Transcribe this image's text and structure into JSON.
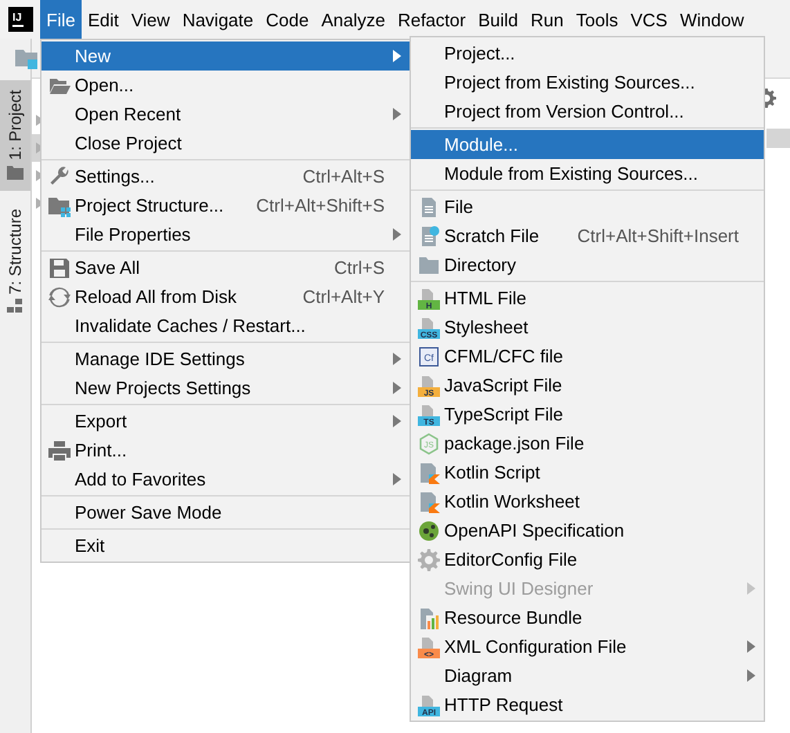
{
  "logo": {
    "text": "IJ"
  },
  "menubar": {
    "items": [
      {
        "label": "File",
        "selected": true
      },
      {
        "label": "Edit",
        "selected": false
      },
      {
        "label": "View",
        "selected": false
      },
      {
        "label": "Navigate",
        "selected": false
      },
      {
        "label": "Code",
        "selected": false
      },
      {
        "label": "Analyze",
        "selected": false
      },
      {
        "label": "Refactor",
        "selected": false
      },
      {
        "label": "Build",
        "selected": false
      },
      {
        "label": "Run",
        "selected": false
      },
      {
        "label": "Tools",
        "selected": false
      },
      {
        "label": "VCS",
        "selected": false
      },
      {
        "label": "Window",
        "selected": false
      }
    ]
  },
  "tool_window_tabs": [
    {
      "label": "1: Project",
      "selected": true,
      "kind": "folder"
    },
    {
      "label": "7: Structure",
      "selected": false,
      "kind": "structure"
    }
  ],
  "file_menu": {
    "sections": [
      [
        {
          "label": "New",
          "selected": true,
          "submenu": true,
          "disabled": false
        },
        {
          "label": "Open...",
          "kind": "folder-open",
          "selected": false,
          "submenu": false,
          "disabled": false
        },
        {
          "label": "Open Recent",
          "selected": false,
          "submenu": true,
          "disabled": false
        },
        {
          "label": "Close Project",
          "selected": false,
          "submenu": false,
          "disabled": false
        }
      ],
      [
        {
          "label": "Settings...",
          "kind": "wrench",
          "shortcut": "Ctrl+Alt+S",
          "selected": false,
          "submenu": false,
          "disabled": false
        },
        {
          "label": "Project Structure...",
          "kind": "project-structure",
          "shortcut": "Ctrl+Alt+Shift+S",
          "selected": false,
          "submenu": false,
          "disabled": false
        },
        {
          "label": "File Properties",
          "selected": false,
          "submenu": true,
          "disabled": false
        }
      ],
      [
        {
          "label": "Save All",
          "kind": "save",
          "shortcut": "Ctrl+S",
          "selected": false,
          "submenu": false,
          "disabled": false
        },
        {
          "label": "Reload All from Disk",
          "kind": "reload",
          "shortcut": "Ctrl+Alt+Y",
          "selected": false,
          "submenu": false,
          "disabled": false
        },
        {
          "label": "Invalidate Caches / Restart...",
          "selected": false,
          "submenu": false,
          "disabled": false
        }
      ],
      [
        {
          "label": "Manage IDE Settings",
          "selected": false,
          "submenu": true,
          "disabled": false
        },
        {
          "label": "New Projects Settings",
          "selected": false,
          "submenu": true,
          "disabled": false
        }
      ],
      [
        {
          "label": "Export",
          "selected": false,
          "submenu": true,
          "disabled": false
        },
        {
          "label": "Print...",
          "kind": "printer",
          "selected": false,
          "submenu": false,
          "disabled": false
        },
        {
          "label": "Add to Favorites",
          "selected": false,
          "submenu": true,
          "disabled": false
        }
      ],
      [
        {
          "label": "Power Save Mode",
          "selected": false,
          "submenu": false,
          "disabled": false
        }
      ],
      [
        {
          "label": "Exit",
          "selected": false,
          "submenu": false,
          "disabled": false
        }
      ]
    ]
  },
  "new_submenu": {
    "sections": [
      [
        {
          "label": "Project...",
          "selected": false,
          "submenu": false,
          "disabled": false
        },
        {
          "label": "Project from Existing Sources...",
          "selected": false,
          "submenu": false,
          "disabled": false
        },
        {
          "label": "Project from Version Control...",
          "selected": false,
          "submenu": false,
          "disabled": false
        }
      ],
      [
        {
          "label": "Module...",
          "selected": true,
          "submenu": false,
          "disabled": false
        },
        {
          "label": "Module from Existing Sources...",
          "selected": false,
          "submenu": false,
          "disabled": false
        }
      ],
      [
        {
          "label": "File",
          "kind": "file",
          "selected": false,
          "submenu": false,
          "disabled": false
        },
        {
          "label": "Scratch File",
          "kind": "scratch",
          "shortcut": "Ctrl+Alt+Shift+Insert",
          "selected": false,
          "submenu": false,
          "disabled": false
        },
        {
          "label": "Directory",
          "kind": "folder",
          "selected": false,
          "submenu": false,
          "disabled": false
        }
      ],
      [
        {
          "label": "HTML File",
          "kind": "badge",
          "badge": "H",
          "color": "#62b543",
          "selected": false,
          "submenu": false,
          "disabled": false
        },
        {
          "label": "Stylesheet",
          "kind": "badge",
          "badge": "CSS",
          "color": "#40b6e0",
          "selected": false,
          "submenu": false,
          "disabled": false
        },
        {
          "label": "CFML/CFC file",
          "kind": "boxed",
          "badge": "Cf",
          "selected": false,
          "submenu": false,
          "disabled": false
        },
        {
          "label": "JavaScript File",
          "kind": "badge",
          "badge": "JS",
          "color": "#f4af3d",
          "selected": false,
          "submenu": false,
          "disabled": false
        },
        {
          "label": "TypeScript File",
          "kind": "badge",
          "badge": "TS",
          "color": "#40b6e0",
          "selected": false,
          "submenu": false,
          "disabled": false
        },
        {
          "label": "package.json File",
          "kind": "hexagon",
          "badge": "JS",
          "selected": false,
          "submenu": false,
          "disabled": false
        },
        {
          "label": "Kotlin Script",
          "kind": "kotlin",
          "selected": false,
          "submenu": false,
          "disabled": false
        },
        {
          "label": "Kotlin Worksheet",
          "kind": "kotlin",
          "selected": false,
          "submenu": false,
          "disabled": false
        },
        {
          "label": "OpenAPI Specification",
          "kind": "openapi",
          "selected": false,
          "submenu": false,
          "disabled": false
        },
        {
          "label": "EditorConfig File",
          "kind": "gear",
          "selected": false,
          "submenu": false,
          "disabled": false
        },
        {
          "label": "Swing UI Designer",
          "selected": false,
          "submenu": true,
          "disabled": true
        },
        {
          "label": "Resource Bundle",
          "kind": "bundle",
          "selected": false,
          "submenu": false,
          "disabled": false
        },
        {
          "label": "XML Configuration File",
          "kind": "badge",
          "badge": "<>",
          "color": "#f98b4a",
          "selected": false,
          "submenu": true,
          "disabled": false
        },
        {
          "label": "Diagram",
          "selected": false,
          "submenu": true,
          "disabled": false
        },
        {
          "label": "HTTP Request",
          "kind": "badge",
          "badge": "API",
          "color": "#40b6e0",
          "selected": false,
          "submenu": false,
          "disabled": false
        }
      ]
    ]
  }
}
